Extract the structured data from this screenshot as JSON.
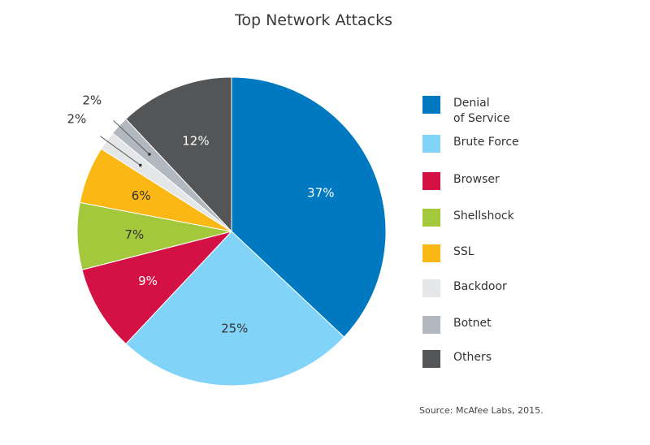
{
  "chart_data": {
    "type": "pie",
    "title": "Top Network Attacks",
    "slices": [
      {
        "label": "Denial\nof Service",
        "value": 37,
        "value_label": "37%",
        "color": "#0079c1",
        "label_color": "#ffffff"
      },
      {
        "label": "Brute Force",
        "value": 25,
        "value_label": "25%",
        "color": "#82d3f8",
        "label_color": "#333333"
      },
      {
        "label": "Browser",
        "value": 9,
        "value_label": "9%",
        "color": "#d31145",
        "label_color": "#ffffff"
      },
      {
        "label": "Shellshock",
        "value": 7,
        "value_label": "7%",
        "color": "#a4c83c",
        "label_color": "#333333"
      },
      {
        "label": "SSL",
        "value": 6,
        "value_label": "6%",
        "color": "#fbb714",
        "label_color": "#333333"
      },
      {
        "label": "Backdoor",
        "value": 2,
        "value_label": "2%",
        "color": "#e5e6e7",
        "label_color": "#333333"
      },
      {
        "label": "Botnet",
        "value": 2,
        "value_label": "2%",
        "color": "#b1b8bf",
        "label_color": "#333333"
      },
      {
        "label": "Others",
        "value": 12,
        "value_label": "12%",
        "color": "#545557",
        "label_color": "#ffffff"
      }
    ],
    "legend_position": "right",
    "source": "Source: McAfee Labs, 2015."
  }
}
